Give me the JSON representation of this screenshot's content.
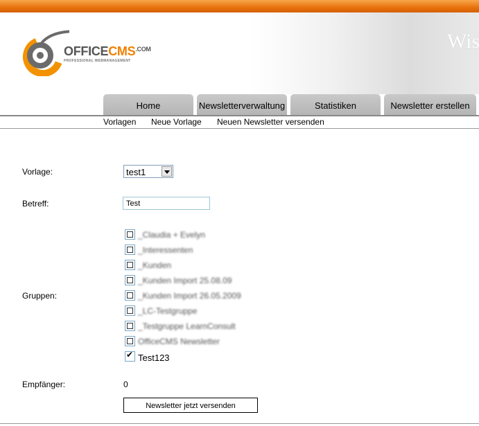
{
  "brand": {
    "name_part1": "OFFICE",
    "name_part2": "CMS",
    "domain": ".COM",
    "tagline": "PROFESSIONAL WEBMANAGEMENT",
    "header_text": "Wis"
  },
  "tabs": [
    {
      "label": "Home"
    },
    {
      "label": "Newsletterverwaltung"
    },
    {
      "label": "Statistiken"
    },
    {
      "label": "Newsletter erstellen"
    }
  ],
  "subnav": [
    {
      "label": "Vorlagen"
    },
    {
      "label": "Neue Vorlage"
    },
    {
      "label": "Neuen Newsletter versenden"
    }
  ],
  "form": {
    "vorlage_label": "Vorlage:",
    "vorlage_value": "test1",
    "betreff_label": "Betreff:",
    "betreff_value": "Test",
    "gruppen_label": "Gruppen:",
    "groups": [
      {
        "label": "_Claudia + Evelyn",
        "checked": false
      },
      {
        "label": "_Interessenten",
        "checked": false
      },
      {
        "label": "_Kunden",
        "checked": false
      },
      {
        "label": "_Kunden Import 25.08.09",
        "checked": false
      },
      {
        "label": "_Kunden Import 26.05.2009",
        "checked": false
      },
      {
        "label": "_LC-Testgruppe",
        "checked": false
      },
      {
        "label": "_Testgruppe LearnConsult",
        "checked": false
      },
      {
        "label": "OfficeCMS Newsletter",
        "checked": false
      },
      {
        "label": "Test123",
        "checked": true
      }
    ],
    "empfaenger_label": "Empfänger:",
    "empfaenger_value": "0",
    "submit_label": "Newsletter jetzt versenden"
  },
  "colors": {
    "accent": "#e8720d",
    "tab_bg": "#bdbdbd"
  }
}
